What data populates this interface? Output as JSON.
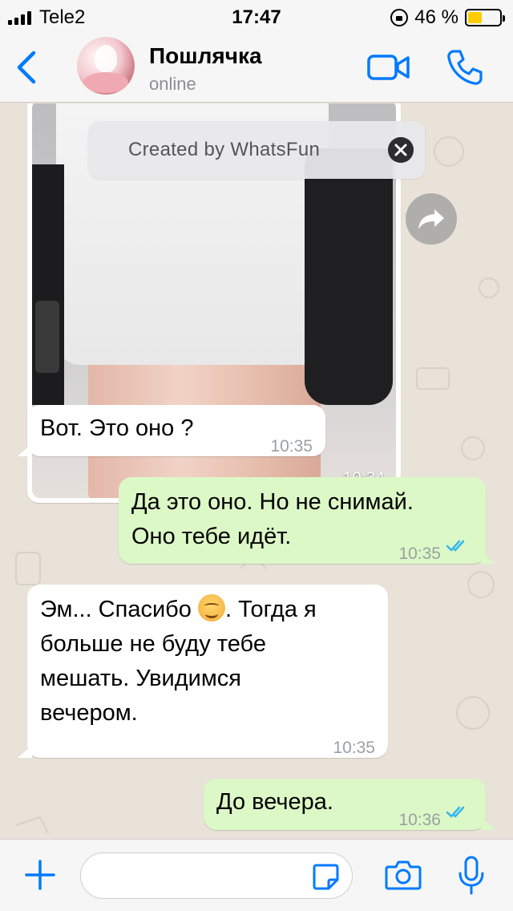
{
  "status_bar": {
    "carrier": "Tele2",
    "time": "17:47",
    "battery_percent": "46 %",
    "battery_level": 0.46
  },
  "header": {
    "contact_name": "Пошлячка",
    "status": "online",
    "back_icon": "chevron-left-icon",
    "video_icon": "video-camera-icon",
    "call_icon": "phone-icon"
  },
  "overlay_banner": {
    "text": "Created by WhatsFun",
    "close_icon": "close-icon"
  },
  "messages": [
    {
      "direction": "in",
      "type": "photo",
      "time": "10:34"
    },
    {
      "direction": "in",
      "text": "Вот. Это оно ?",
      "time": "10:35"
    },
    {
      "direction": "out",
      "lines": [
        "Да это оно. Но не снимай.",
        "Оно тебе идёт."
      ],
      "time": "10:35",
      "status": "read"
    },
    {
      "direction": "in",
      "lines_before": "Эм... Спасибо",
      "lines_after": ". Тогда я",
      "lines": [
        "больше не буду тебе",
        "мешать. Увидимся",
        "вечером."
      ],
      "emoji": "relieved-smile-emoji",
      "time": "10:35"
    },
    {
      "direction": "out",
      "text": "До вечера.",
      "time": "10:36",
      "status": "read"
    }
  ],
  "input_bar": {
    "plus_icon": "plus-icon",
    "placeholder": "",
    "sticker_icon": "sticker-icon",
    "camera_icon": "camera-icon",
    "mic_icon": "microphone-icon"
  },
  "colors": {
    "accent": "#007aff",
    "outgoing_bubble": "#dcf8c6",
    "incoming_bubble": "#ffffff",
    "read_ticks": "#34b7f1",
    "battery": "#ffcc00"
  }
}
